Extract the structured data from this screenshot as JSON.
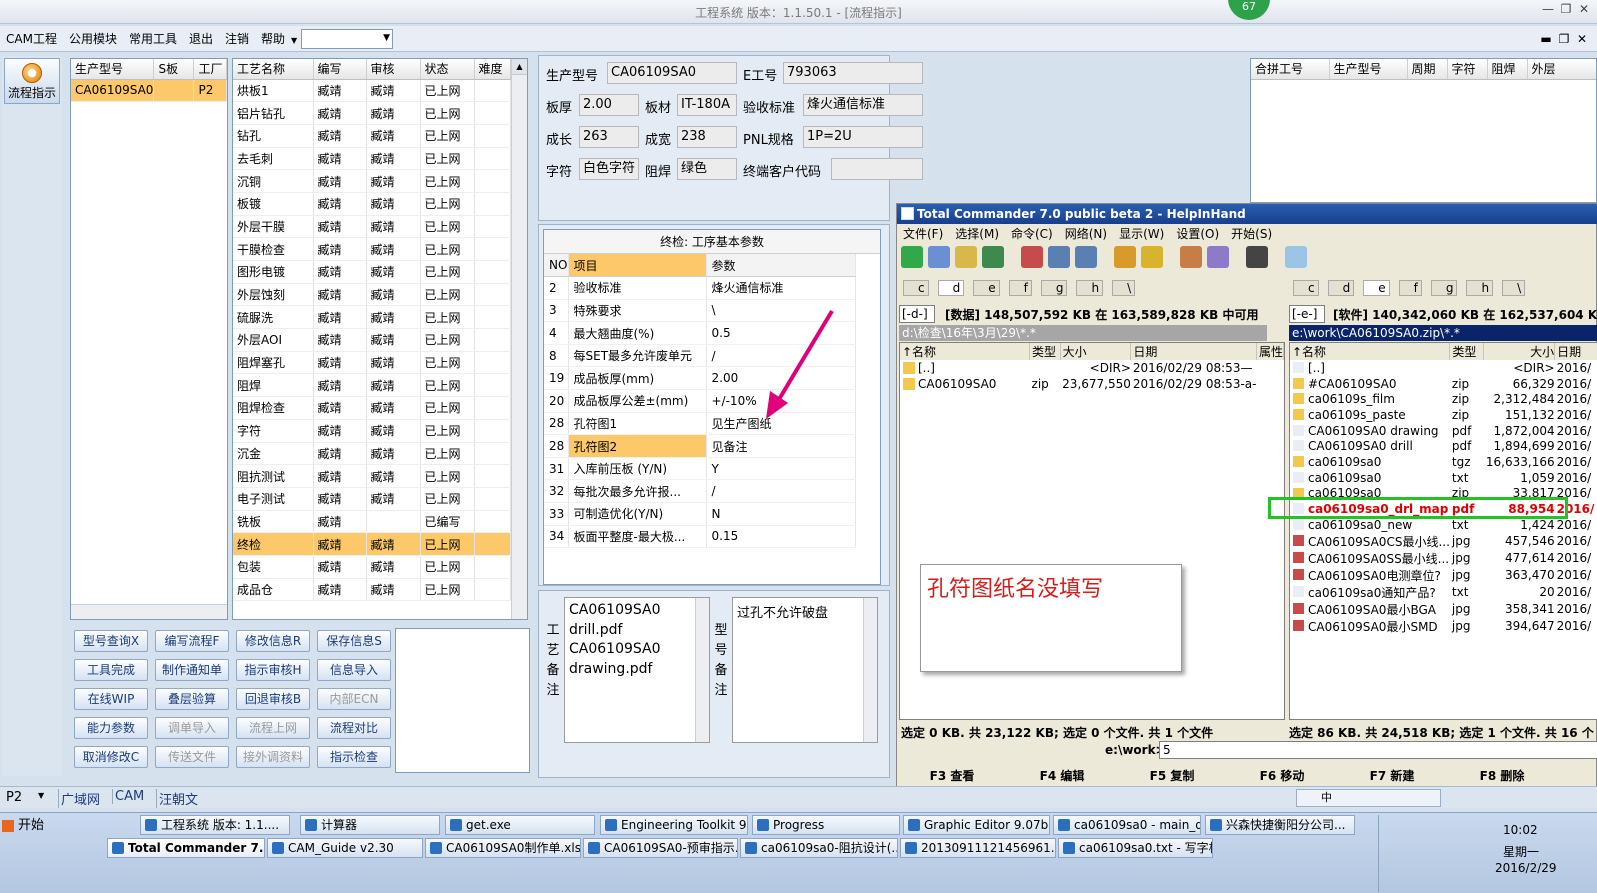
{
  "window": {
    "title": "工程系统   版本：1.1.50.1 - [流程指示]",
    "badge": "67"
  },
  "menu": {
    "items": [
      "CAM工程",
      "公用模块",
      "常用工具",
      "退出",
      "注销",
      "帮助"
    ]
  },
  "side": {
    "flow_btn": "流程指示"
  },
  "prod_list": {
    "headers": [
      "生产型号",
      "S板",
      "工厂"
    ],
    "rows": [
      [
        "CA06109SA0",
        "",
        "P2"
      ]
    ]
  },
  "process": {
    "headers": [
      "工艺名称",
      "编写",
      "审核",
      "状态",
      "难度"
    ],
    "rows": [
      [
        "烘板1",
        "臧靖",
        "臧靖",
        "已上网"
      ],
      [
        "铝片钻孔",
        "臧靖",
        "臧靖",
        "已上网"
      ],
      [
        "钻孔",
        "臧靖",
        "臧靖",
        "已上网"
      ],
      [
        "去毛刺",
        "臧靖",
        "臧靖",
        "已上网"
      ],
      [
        "沉铜",
        "臧靖",
        "臧靖",
        "已上网"
      ],
      [
        "板镀",
        "臧靖",
        "臧靖",
        "已上网"
      ],
      [
        "外层干膜",
        "臧靖",
        "臧靖",
        "已上网"
      ],
      [
        "干膜检查",
        "臧靖",
        "臧靖",
        "已上网"
      ],
      [
        "图形电镀",
        "臧靖",
        "臧靖",
        "已上网"
      ],
      [
        "外层蚀刻",
        "臧靖",
        "臧靖",
        "已上网"
      ],
      [
        "硫脲洗",
        "臧靖",
        "臧靖",
        "已上网"
      ],
      [
        "外层AOI",
        "臧靖",
        "臧靖",
        "已上网"
      ],
      [
        "阻焊塞孔",
        "臧靖",
        "臧靖",
        "已上网"
      ],
      [
        "阻焊",
        "臧靖",
        "臧靖",
        "已上网"
      ],
      [
        "阻焊检查",
        "臧靖",
        "臧靖",
        "已上网"
      ],
      [
        "字符",
        "臧靖",
        "臧靖",
        "已上网"
      ],
      [
        "沉金",
        "臧靖",
        "臧靖",
        "已上网"
      ],
      [
        "阻抗测试",
        "臧靖",
        "臧靖",
        "已上网"
      ],
      [
        "电子测试",
        "臧靖",
        "臧靖",
        "已上网"
      ],
      [
        "铣板",
        "臧靖",
        "",
        "已编写"
      ],
      [
        "终检",
        "臧靖",
        "臧靖",
        "已上网"
      ],
      [
        "包装",
        "臧靖",
        "臧靖",
        "已上网"
      ],
      [
        "成品仓",
        "臧靖",
        "臧靖",
        "已上网"
      ]
    ]
  },
  "buttons": [
    [
      "型号查询X",
      "编写流程F",
      "修改信息R",
      "保存信息S"
    ],
    [
      "工具完成",
      "制作通知单",
      "指示审核H",
      "信息导入"
    ],
    [
      "在线WIP",
      "叠层验算",
      "回退审核B",
      "内部ECN"
    ],
    [
      "能力参数",
      "调单导入",
      "流程上网",
      "流程对比"
    ],
    [
      "取消修改C",
      "传送文件",
      "接外调资料",
      "指示检查"
    ]
  ],
  "info": {
    "l_model": "生产型号",
    "model": "CA06109SA0",
    "l_e": "E工号",
    "e": "793063",
    "l_thick": "板厚",
    "thick": "2.00",
    "l_mat": "板材",
    "mat": "IT-180A",
    "l_std": "验收标准",
    "std": "烽火通信标准",
    "l_len": "成长",
    "len": "263",
    "l_wid": "成宽",
    "wid": "238",
    "l_pnl": "PNL规格",
    "pnl": "1P=2U",
    "l_char": "字符",
    "char": "白色字符",
    "l_mask": "阻焊",
    "mask": "绿色",
    "l_cust": "终端客户代码",
    "cust": ""
  },
  "params": {
    "title": "终检: 工序基本参数",
    "headers": [
      "NO",
      "项目",
      "参数"
    ],
    "rows": [
      [
        "2",
        "验收标准",
        "烽火通信标准"
      ],
      [
        "3",
        "特殊要求",
        "\\"
      ],
      [
        "4",
        "最大翘曲度(%)",
        "0.5"
      ],
      [
        "8",
        "每SET最多允许废单元",
        "/"
      ],
      [
        "19",
        "成品板厚(mm)",
        "2.00"
      ],
      [
        "20",
        "成品板厚公差±(mm)",
        "+/-10%"
      ],
      [
        "28",
        "孔符图1",
        "见生产图纸"
      ],
      [
        "28",
        "孔符图2",
        "见备注"
      ],
      [
        "31",
        "入库前压板 (Y/N)",
        "Y"
      ],
      [
        "32",
        "每批次最多允许报...",
        "/"
      ],
      [
        "33",
        "可制造优化(Y/N)",
        "N"
      ],
      [
        "34",
        "板面平整度-最大极...",
        "0.15"
      ]
    ]
  },
  "notes": {
    "proc_label": "工艺备注",
    "proc_lines": [
      "CA06109SA0",
      "drill.pdf",
      "CA06109SA0",
      "drawing.pdf"
    ],
    "model_label": "型号备注",
    "model_text": "过孔不允许破盘"
  },
  "merge": {
    "headers": [
      "合拼工号",
      "生产型号",
      "周期",
      "字符",
      "阻焊",
      "外层"
    ]
  },
  "tc": {
    "title": "Total Commander 7.0 public beta 2 - HelpInHand",
    "menu": [
      "文件(F)",
      "选择(M)",
      "命令(C)",
      "网络(N)",
      "显示(W)",
      "设置(O)",
      "开始(S)"
    ],
    "drives": [
      "c",
      "d",
      "e",
      "f",
      "g",
      "h",
      "\\"
    ],
    "left": {
      "drive": "[-d-]",
      "info": "[数据]  148,507,592 KB 在 163,589,828 KB 中可用",
      "path": "d:\\检查\\16年\\3月\\29\\*.*",
      "headers": [
        "↑名称",
        "类型",
        "大小",
        "日期",
        "属性"
      ],
      "files": [
        [
          "[..]",
          "",
          "<DIR>",
          "2016/02/29 08:53—"
        ],
        [
          "CA06109SA0",
          "zip",
          "23,677,550",
          "2016/02/29 08:53-a-"
        ]
      ],
      "status": "选定 0 KB. 共 23,122 KB; 选定 0 个文件. 共 1 个文件"
    },
    "right": {
      "drive": "[-e-]",
      "info": "[软件]  140,342,060 KB 在 162,537,604 K",
      "path": "e:\\work\\CA06109SA0.zip\\*.*",
      "headers": [
        "↑名称",
        "类型",
        "大小",
        "日期"
      ],
      "files": [
        [
          "[..]",
          "",
          "<DIR>",
          "2016/"
        ],
        [
          "#CA06109SA0",
          "zip",
          "66,329",
          "2016/"
        ],
        [
          "ca06109s_film",
          "zip",
          "2,312,484",
          "2016/"
        ],
        [
          "ca06109s_paste",
          "zip",
          "151,132",
          "2016/"
        ],
        [
          "CA06109SA0 drawing",
          "pdf",
          "1,872,004",
          "2016/"
        ],
        [
          "CA06109SA0 drill",
          "pdf",
          "1,894,699",
          "2016/"
        ],
        [
          "ca06109sa0",
          "tgz",
          "16,633,166",
          "2016/"
        ],
        [
          "ca06109sa0",
          "txt",
          "1,059",
          "2016/"
        ],
        [
          "ca06109sa0",
          "zip",
          "33,817",
          "2016/"
        ],
        [
          "ca06109sa0_drl_map",
          "pdf",
          "88,954",
          "2016/"
        ],
        [
          "ca06109sa0_new",
          "txt",
          "1,424",
          "2016/"
        ],
        [
          "CA06109SA0CS最小线...",
          "jpg",
          "457,546",
          "2016/"
        ],
        [
          "CA06109SA0SS最小线...",
          "jpg",
          "477,614",
          "2016/"
        ],
        [
          "CA06109SA0电测章位?",
          "jpg",
          "363,470",
          "2016/"
        ],
        [
          "ca06109sa0通知产品?",
          "txt",
          "20",
          "2016/"
        ],
        [
          "CA06109SA0最小BGA",
          "jpg",
          "358,341",
          "2016/"
        ],
        [
          "CA06109SA0最小SMD",
          "jpg",
          "394,647",
          "2016/"
        ]
      ],
      "status": "选定 86 KB. 共 24,518 KB; 选定 1 个文件. 共 16 个"
    },
    "cmd_label": "e:\\work>",
    "cmd_value": "5",
    "fkeys": [
      "F3 查看",
      "F4 编辑",
      "F5 复制",
      "F6 移动",
      "F7 新建",
      "F8 删除"
    ]
  },
  "annotation": "孔符图纸名没填写",
  "statusbar": {
    "items": [
      "P2",
      "广域网",
      "CAM",
      "汪朝文"
    ]
  },
  "taskbar": {
    "start": "开始",
    "row1": [
      "工程系统  版本: 1.1....",
      "计算器",
      "get.exe",
      "Engineering Toolkit 9.0...",
      "Progress",
      "Graphic Editor 9.07b2 (...",
      "ca06109sa0 - main_qa",
      "兴森快捷衡阳分公司..."
    ],
    "row2": [
      "Total Commander 7.0...",
      "CAM_Guide v2.30",
      "CA06109SA0制作单.xls ...",
      "CA06109SA0-预审指示...",
      "ca06109sa0-阻抗设计(...",
      "20130911121456961.rtf...",
      "ca06109sa0.txt - 写字板"
    ],
    "time": "10:02",
    "day": "星期一",
    "date": "2016/2/29",
    "ime": "中"
  },
  "colors": {
    "highlight": "#fcc86a",
    "annotation": "#e0007a",
    "tc_title": "#173f8d",
    "green_box": "#22c322"
  }
}
